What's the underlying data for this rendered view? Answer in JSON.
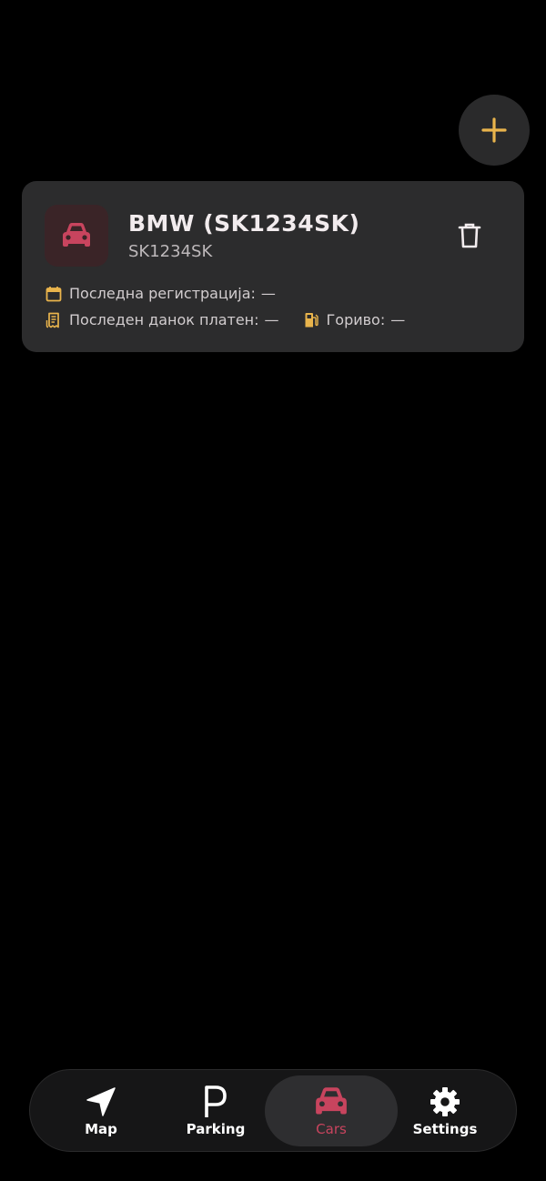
{
  "header": {
    "add_icon": "plus-icon",
    "accent_color": "#e9b44c"
  },
  "cars": [
    {
      "name": "BMW (SK1234SK)",
      "plate": "SK1234SK",
      "icon": "car-icon",
      "icon_color": "#c8445e",
      "last_registration_label": "Последна регистрација:",
      "last_registration_value": "—",
      "last_tax_label": "Последен данок платен:",
      "last_tax_value": "—",
      "fuel_label": "Гориво:",
      "fuel_value": "—"
    }
  ],
  "tabbar": {
    "tabs": [
      {
        "label": "Map",
        "icon": "navigation-arrow-icon"
      },
      {
        "label": "Parking",
        "icon": "parking-p-icon"
      },
      {
        "label": "Cars",
        "icon": "car-icon",
        "selected": true
      },
      {
        "label": "Settings",
        "icon": "gear-icon"
      }
    ],
    "active_color": "#c8445e"
  }
}
